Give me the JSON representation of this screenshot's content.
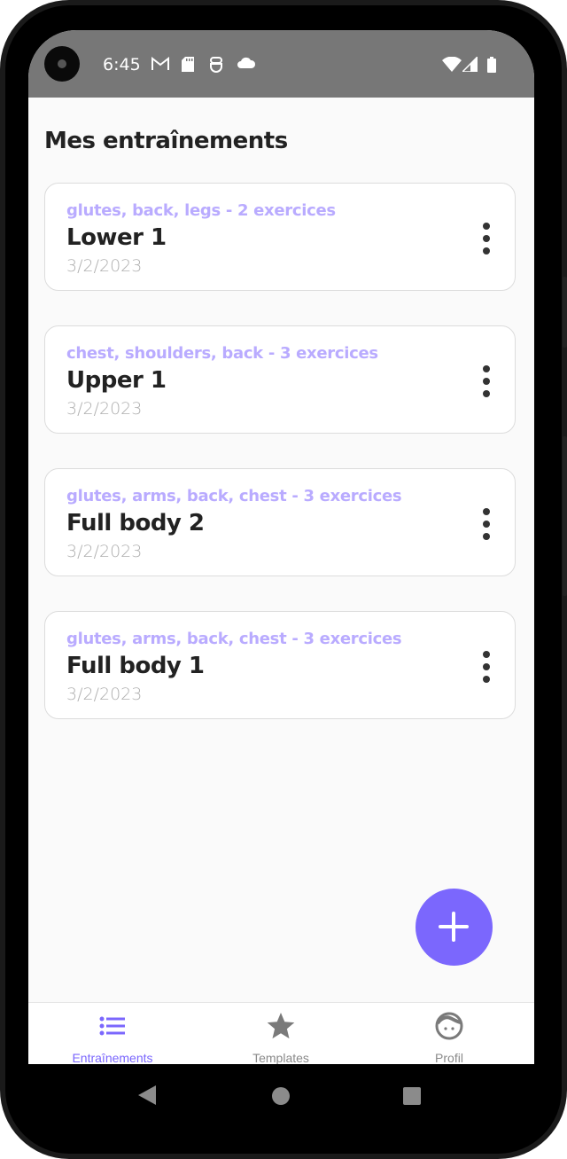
{
  "status_bar": {
    "time": "6:45",
    "left_icons": [
      "gmail-icon",
      "sd-card-icon",
      "app-notification-icon",
      "cloud-icon"
    ],
    "right_icons": [
      "wifi-icon",
      "cellular-signal-icon",
      "battery-icon"
    ]
  },
  "page": {
    "title": "Mes entraînements"
  },
  "workouts": [
    {
      "tags": "glutes, back, legs - 2 exercices",
      "name": "Lower 1",
      "date": "3/2/2023"
    },
    {
      "tags": "chest, shoulders, back - 3 exercices",
      "name": "Upper 1",
      "date": "3/2/2023"
    },
    {
      "tags": "glutes, arms, back, chest - 3 exercices",
      "name": "Full body 2",
      "date": "3/2/2023"
    },
    {
      "tags": "glutes, arms, back, chest - 3 exercices",
      "name": "Full body 1",
      "date": "3/2/2023"
    }
  ],
  "fab": {
    "icon": "plus-icon"
  },
  "bottom_nav": {
    "items": [
      {
        "label": "Entraînements",
        "icon": "list-icon",
        "active": true
      },
      {
        "label": "Templates",
        "icon": "star-icon",
        "active": false
      },
      {
        "label": "Profil",
        "icon": "face-icon",
        "active": false
      }
    ]
  },
  "colors": {
    "accent": "#7b67fd",
    "tag_text": "#b9abff",
    "status_bar": "#777777"
  }
}
